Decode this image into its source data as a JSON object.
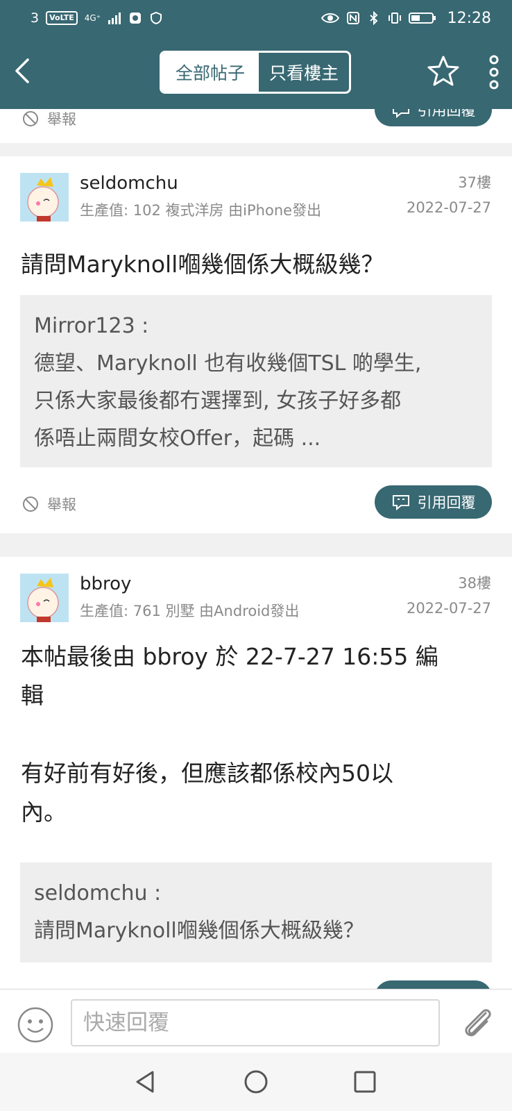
{
  "status_bar": {
    "carrier_left": "3",
    "volte": "VoLTE",
    "network": "4G⁺",
    "time": "12:28"
  },
  "toolbar": {
    "tab_all": "全部帖子",
    "tab_op": "只看樓主"
  },
  "colors": {
    "header": "#386872",
    "accent": "#386872",
    "quote_bg": "#eeeeee",
    "muted_text": "#8a8a8a"
  },
  "prev_post": {
    "report_label": "舉報",
    "quote_reply_label": "引用回覆"
  },
  "posts": [
    {
      "username": "seldomchu",
      "meta": "生產值: 102   複式洋房   由iPhone發出",
      "floor": "37樓",
      "date": "2022-07-27",
      "body_lines": [
        "請問Maryknoll嗰幾個係大概級幾？"
      ],
      "quote_author": "Mirror123 :",
      "quote_lines": [
        "德望、Maryknoll 也有收幾個TSL 啲學生,",
        "只係大家最後都冇選擇到, 女孩子好多都",
        "係唔止兩間女校Offer，起碼 ..."
      ],
      "report_label": "舉報",
      "quote_reply_label": "引用回覆"
    },
    {
      "username": "bbroy",
      "meta": "生產值: 761   別墅   由Android發出",
      "floor": "38樓",
      "date": "2022-07-27",
      "edit_note_lines": [
        "本帖最後由 bbroy 於 22-7-27 16:55 編",
        "輯"
      ],
      "body_lines": [
        "有好前有好後，但應該都係校內50以",
        "內。"
      ],
      "quote_author": "seldomchu :",
      "quote_lines": [
        "請問Maryknoll嗰幾個係大概級幾？"
      ]
    }
  ],
  "reply_bar": {
    "placeholder": "快速回覆"
  },
  "icons": [
    "back-icon",
    "star-icon",
    "more-icon",
    "report-icon",
    "quote-reply-icon",
    "emoji-icon",
    "attach-icon",
    "nav-back-icon",
    "nav-home-icon",
    "nav-recents-icon"
  ]
}
